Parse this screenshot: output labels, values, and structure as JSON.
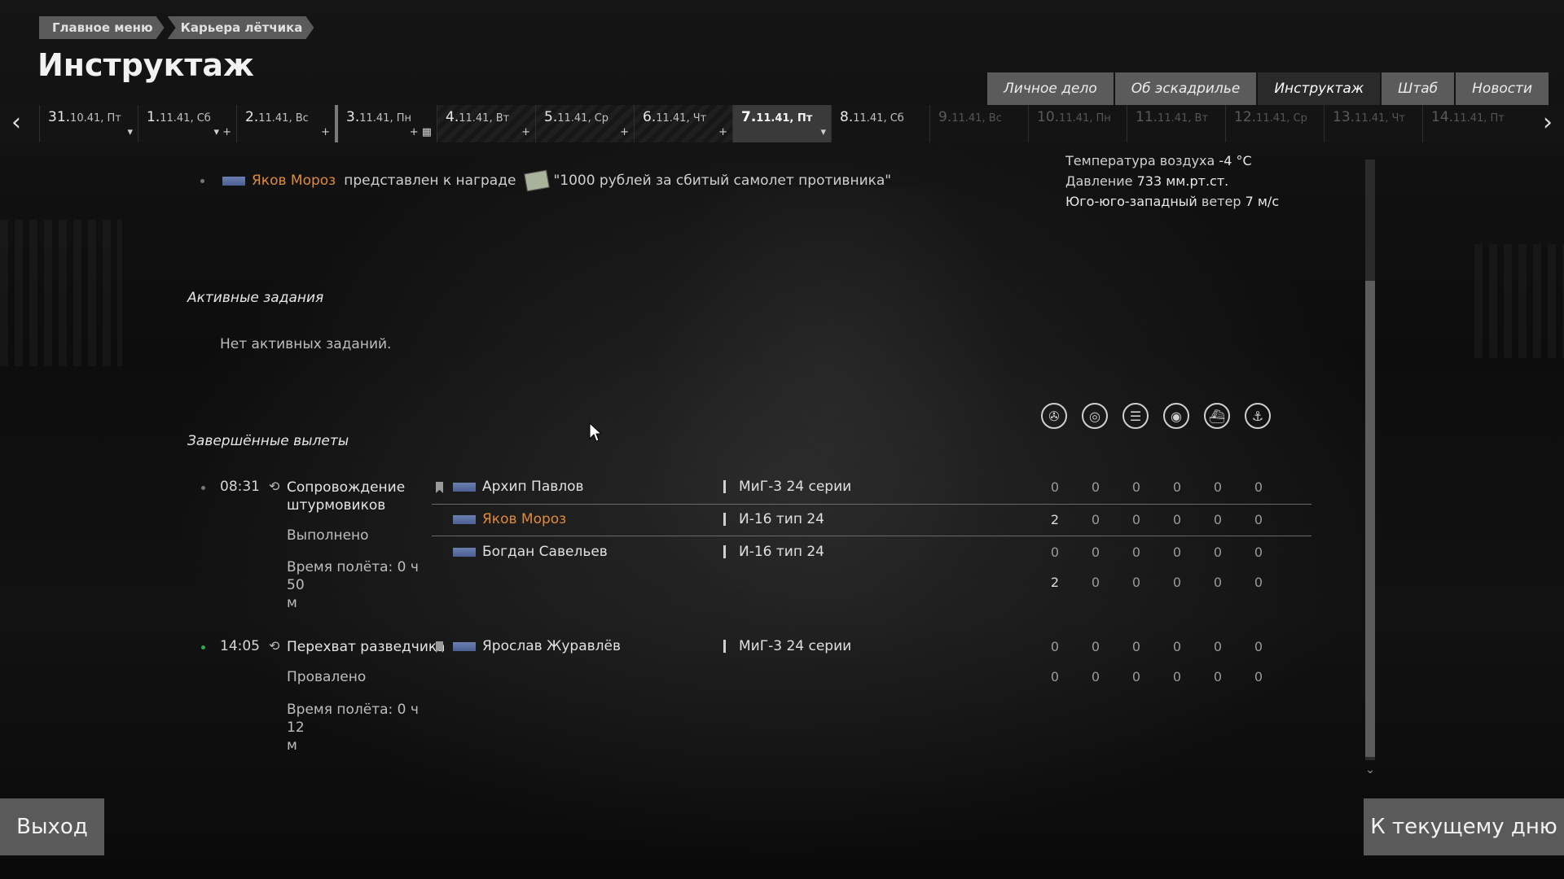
{
  "breadcrumb": [
    "Главное меню",
    "Карьера лётчика"
  ],
  "page_title": "Инструктаж",
  "tabs": [
    {
      "label": "Личное дело",
      "active": false
    },
    {
      "label": "Об эскадрилье",
      "active": false
    },
    {
      "label": "Инструктаж",
      "active": true
    },
    {
      "label": "Штаб",
      "active": false
    },
    {
      "label": "Новости",
      "active": false
    }
  ],
  "dates": [
    {
      "num": "31.",
      "rest": "10.41, Пт"
    },
    {
      "num": "1.",
      "rest": "11.41, Сб"
    },
    {
      "num": "2.",
      "rest": "11.41, Вс"
    },
    {
      "num": "3.",
      "rest": "11.41, Пн"
    },
    {
      "num": "4.",
      "rest": "11.41, Вт"
    },
    {
      "num": "5.",
      "rest": "11.41, Ср"
    },
    {
      "num": "6.",
      "rest": "11.41, Чт"
    },
    {
      "num": "7.",
      "rest": "11.41, Пт"
    },
    {
      "num": "8.",
      "rest": "11.41, Сб"
    },
    {
      "num": "9.",
      "rest": "11.41, Вс"
    },
    {
      "num": "10.",
      "rest": "11.41, Пн"
    },
    {
      "num": "11.",
      "rest": "11.41, Вт"
    },
    {
      "num": "12.",
      "rest": "11.41, Ср"
    },
    {
      "num": "13.",
      "rest": "11.41, Чт"
    },
    {
      "num": "14.",
      "rest": "11.41, Пт"
    }
  ],
  "award": {
    "pilot": "Яков Мороз",
    "text": "представлен к награде",
    "award_name": "\"1000 рублей за сбитый самолет противника\""
  },
  "weather": {
    "temp_label": "Температура воздуха",
    "temp_value": "-4 °C",
    "pressure_label": "Давление",
    "pressure_value": "733 мм.рт.ст.",
    "wind_dir": "Юго-юго-западный",
    "wind_label": "ветер",
    "wind_value": "7 м/с"
  },
  "active_tasks": {
    "title": "Активные задания",
    "empty": "Нет активных заданий."
  },
  "completed": {
    "title": "Завершённые вылеты",
    "stat_icons": [
      "aircraft-kills-icon",
      "ground-target-icon",
      "armor-target-icon",
      "artillery-target-icon",
      "ship-icon",
      "naval-icon"
    ],
    "sorties": [
      {
        "time": "08:31",
        "name_line1": "Сопровождение",
        "name_line2": "штурмовиков",
        "status": "Выполнено",
        "duration_line1": "Время полёта: 0 ч 50",
        "duration_line2": "м",
        "rows": [
          {
            "pilot": "Архип Павлов",
            "plane": "МиГ-3 24 серии",
            "stats": [
              "0",
              "0",
              "0",
              "0",
              "0",
              "0"
            ]
          },
          {
            "pilot": "Яков Мороз",
            "plane": "И-16 тип 24",
            "stats": [
              "2",
              "0",
              "0",
              "0",
              "0",
              "0"
            ]
          },
          {
            "pilot": "Богдан Савельев",
            "plane": "И-16 тип 24",
            "stats": [
              "0",
              "0",
              "0",
              "0",
              "0",
              "0"
            ]
          }
        ],
        "totals": [
          "2",
          "0",
          "0",
          "0",
          "0",
          "0"
        ]
      },
      {
        "time": "14:05",
        "name_line1": "Перехват разведчика",
        "status": "Провалено",
        "duration_line1": "Время полёта: 0 ч 12",
        "duration_line2": "м",
        "rows": [
          {
            "pilot": "Ярослав Журавлёв",
            "plane": "МиГ-3 24 серии",
            "stats": [
              "0",
              "0",
              "0",
              "0",
              "0",
              "0"
            ]
          }
        ],
        "totals": [
          "0",
          "0",
          "0",
          "0",
          "0",
          "0"
        ]
      }
    ]
  },
  "buttons": {
    "exit": "Выход",
    "today": "К текущему дню"
  }
}
